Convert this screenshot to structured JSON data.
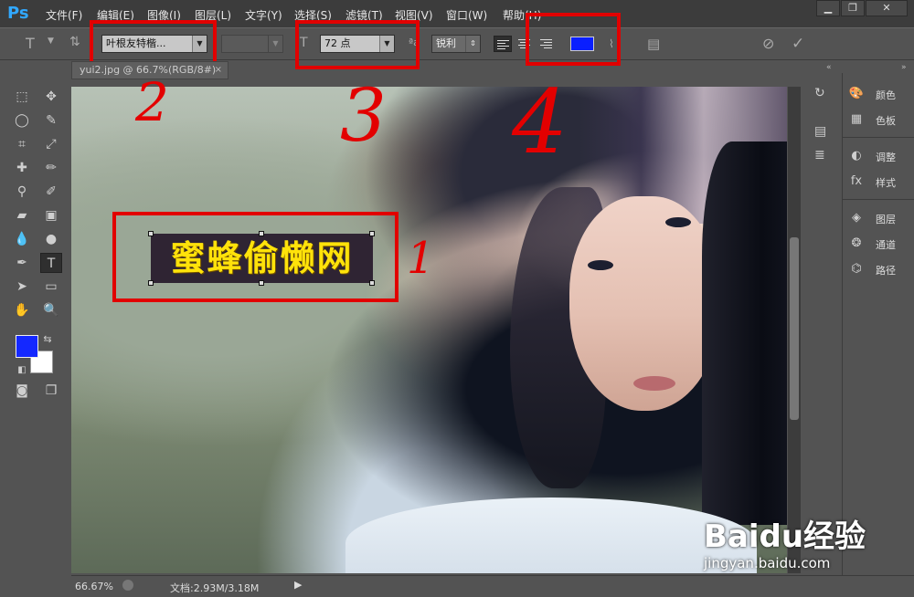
{
  "app": {
    "logo": "Ps"
  },
  "menu": [
    "文件(F)",
    "编辑(E)",
    "图像(I)",
    "图层(L)",
    "文字(Y)",
    "选择(S)",
    "滤镜(T)",
    "视图(V)",
    "窗口(W)",
    "帮助(H)"
  ],
  "window_controls": {
    "minimize": "▁",
    "restore": "❐",
    "close": "✕"
  },
  "options_bar": {
    "font_family": "叶根友特楷...",
    "font_style": "",
    "font_size": "72 点",
    "antialias": "锐利",
    "text_color": "#0a1fff"
  },
  "document_tab": {
    "title": "yui2.jpg @ 66.7%(RGB/8#)",
    "close": "×"
  },
  "canvas": {
    "text_layer": "蜜蜂偷懒网"
  },
  "annotations": [
    "1",
    "2",
    "3",
    "4"
  ],
  "colors": {
    "foreground": "#1428ff",
    "background": "#ffffff",
    "annotation_red": "#e10000"
  },
  "right_panel": {
    "items": [
      {
        "icon": "palette-icon",
        "label": "颜色"
      },
      {
        "icon": "swatches-icon",
        "label": "色板"
      },
      {
        "icon": "adjustments-icon",
        "label": "调整"
      },
      {
        "icon": "styles-icon",
        "label": "样式"
      },
      {
        "icon": "layers-icon",
        "label": "图层"
      },
      {
        "icon": "channels-icon",
        "label": "通道"
      },
      {
        "icon": "paths-icon",
        "label": "路径"
      }
    ]
  },
  "status": {
    "zoom": "66.67%",
    "doc_info": "文档:2.93M/3.18M"
  },
  "watermark": {
    "brand": "Baidu经验",
    "url": "jingyan.baidu.com"
  }
}
